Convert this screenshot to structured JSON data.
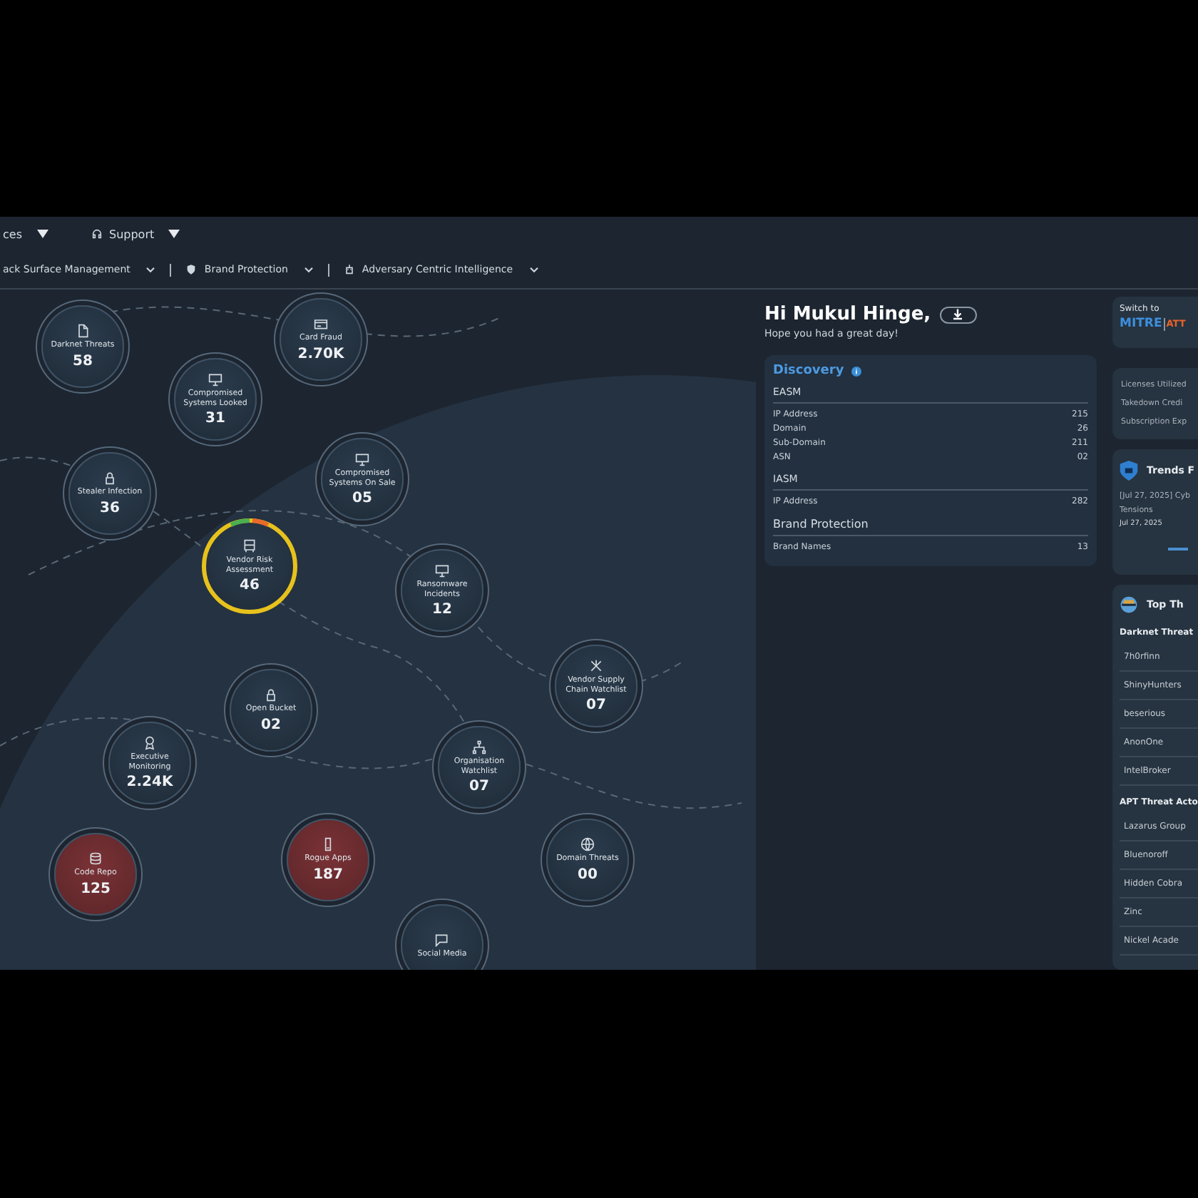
{
  "top_menu": [
    {
      "label": "ces",
      "has_icon": false
    },
    {
      "label": "Support",
      "has_icon": true
    }
  ],
  "sub_menu": [
    {
      "label": "ack Surface Management",
      "has_icon": false
    },
    {
      "label": "Brand Protection",
      "has_icon": true
    },
    {
      "label": "Adversary Centric Intelligence",
      "has_icon": true
    }
  ],
  "nodes": [
    {
      "label": "Darknet Threats",
      "value": "58",
      "kind": "normal",
      "selected": false
    },
    {
      "label": "Card Fraud",
      "value": "2.70K",
      "kind": "normal",
      "selected": false
    },
    {
      "label": "Compromised Systems Looked",
      "value": "31",
      "kind": "normal",
      "selected": false
    },
    {
      "label": "Stealer Infection",
      "value": "36",
      "kind": "normal",
      "selected": false
    },
    {
      "label": "Compromised Systems On Sale",
      "value": "05",
      "kind": "normal",
      "selected": false
    },
    {
      "label": "Vendor Risk Assessment",
      "value": "46",
      "kind": "normal",
      "selected": true
    },
    {
      "label": "Ransomware Incidents",
      "value": "12",
      "kind": "normal",
      "selected": false
    },
    {
      "label": "Open Bucket",
      "value": "02",
      "kind": "normal",
      "selected": false
    },
    {
      "label": "Vendor Supply Chain Watchlist",
      "value": "07",
      "kind": "normal",
      "selected": false
    },
    {
      "label": "Executive Monitoring",
      "value": "2.24K",
      "kind": "normal",
      "selected": false
    },
    {
      "label": "Organisation Watchlist",
      "value": "07",
      "kind": "normal",
      "selected": false
    },
    {
      "label": "Code Repo",
      "value": "125",
      "kind": "alert",
      "selected": false
    },
    {
      "label": "Rogue Apps",
      "value": "187",
      "kind": "alert",
      "selected": false
    },
    {
      "label": "Domain Threats",
      "value": "00",
      "kind": "normal",
      "selected": false
    },
    {
      "label": "Social Media",
      "kind": "normal",
      "selected": false
    }
  ],
  "welcome": {
    "title": "Hi Mukul Hinge,",
    "subtitle": "Hope you had a great day!"
  },
  "discovery": {
    "title": "Discovery",
    "sections": [
      {
        "title": "EASM",
        "rows": [
          {
            "label": "IP Address",
            "value": "215"
          },
          {
            "label": "Domain",
            "value": "26"
          },
          {
            "label": "Sub-Domain",
            "value": "211"
          },
          {
            "label": "ASN",
            "value": "02"
          }
        ]
      },
      {
        "title": "IASM",
        "rows": [
          {
            "label": "IP Address",
            "value": "282"
          }
        ]
      },
      {
        "title": "Brand Protection",
        "rows": [
          {
            "label": "Brand Names",
            "value": "13"
          }
        ]
      }
    ]
  },
  "switch_card": {
    "label": "Switch to",
    "brand": "MITRE",
    "brand_suffix": "ATT"
  },
  "license_card": {
    "rows": [
      "Licenses Utilized",
      "Takedown Credi",
      "Subscription Exp"
    ]
  },
  "trends_card": {
    "title": "Trends F",
    "headline": "[Jul 27, 2025] Cyb",
    "headline_2": "Tensions",
    "date": "Jul 27, 2025"
  },
  "threats_card": {
    "title": "Top Th",
    "groups": [
      {
        "title": "Darknet Threat",
        "items": [
          "7h0rfinn",
          "ShinyHunters",
          "beserious",
          "AnonOne",
          "IntelBroker"
        ]
      },
      {
        "title": "APT Threat Acto",
        "items": [
          "Lazarus Group",
          "Bluenoroff",
          "Hidden Cobra",
          "Zinc",
          "Nickel Acade"
        ]
      }
    ]
  }
}
